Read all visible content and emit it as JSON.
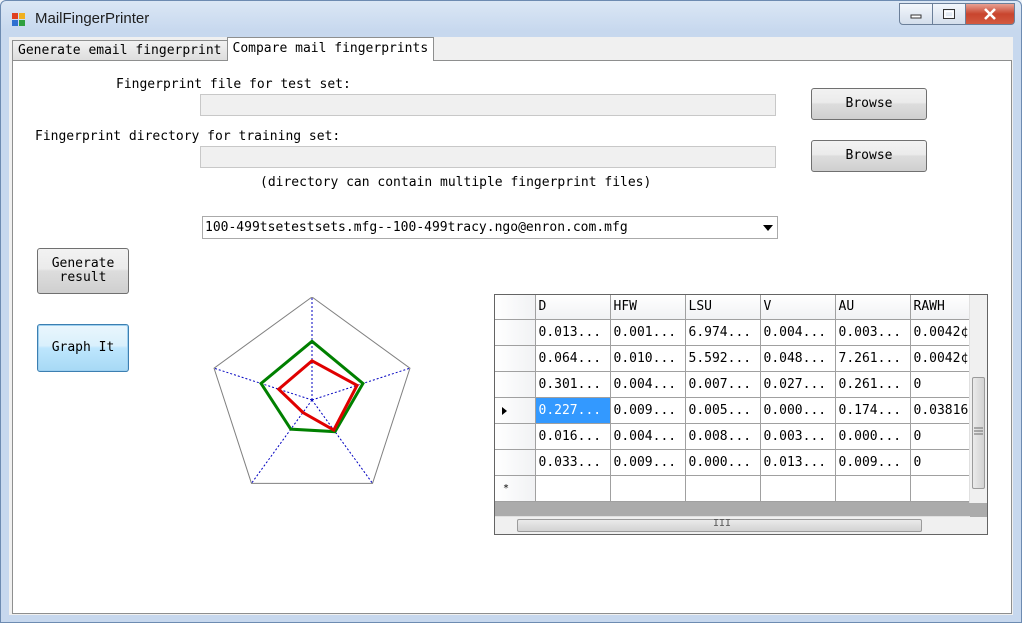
{
  "window": {
    "title": "MailFingerPrinter"
  },
  "tabs": [
    {
      "label": "Generate email fingerprint",
      "active": false
    },
    {
      "label": "Compare mail fingerprints",
      "active": true
    }
  ],
  "form": {
    "test_label": "Fingerprint file for test set:",
    "test_value": "",
    "training_label": "Fingerprint directory for training set:",
    "training_value": "",
    "directory_hint": "(directory can contain multiple fingerprint files)",
    "browse_label": "Browse",
    "comparison_selected": "100-499tsetestsets.mfg--100-499tracy.ngo@enron.com.mfg"
  },
  "buttons": {
    "generate_result": "Generate result",
    "graph_it": "Graph It"
  },
  "grid": {
    "columns": [
      "D",
      "HFW",
      "LSU",
      "V",
      "AU",
      "RAWH"
    ],
    "rows": [
      [
        "0.013...",
        "0.001...",
        "6.974...",
        "0.004...",
        "0.003...",
        "0.0042¢"
      ],
      [
        "0.064...",
        "0.010...",
        "5.592...",
        "0.048...",
        "7.261...",
        "0.0042¢"
      ],
      [
        "0.301...",
        "0.004...",
        "0.007...",
        "0.027...",
        "0.261...",
        "0"
      ],
      [
        "0.227...",
        "0.009...",
        "0.005...",
        "0.000...",
        "0.174...",
        "0.03816"
      ],
      [
        "0.016...",
        "0.004...",
        "0.008...",
        "0.003...",
        "0.000...",
        "0"
      ],
      [
        "0.033...",
        "0.009...",
        "0.000...",
        "0.013...",
        "0.009...",
        "0"
      ]
    ],
    "current_row": 3,
    "new_row_marker": "*",
    "scroll_thumb_mark": "III"
  },
  "radar": {
    "axes": 5,
    "outline_color": "#808080",
    "axis_color": "#0000c0",
    "series": [
      {
        "color": "#008000",
        "values": [
          0.57,
          0.52,
          0.38,
          0.35,
          0.52
        ]
      },
      {
        "color": "#e00000",
        "values": [
          0.38,
          0.46,
          0.36,
          0.15,
          0.34
        ]
      }
    ]
  },
  "colors": {
    "selection": "#3399ff"
  }
}
